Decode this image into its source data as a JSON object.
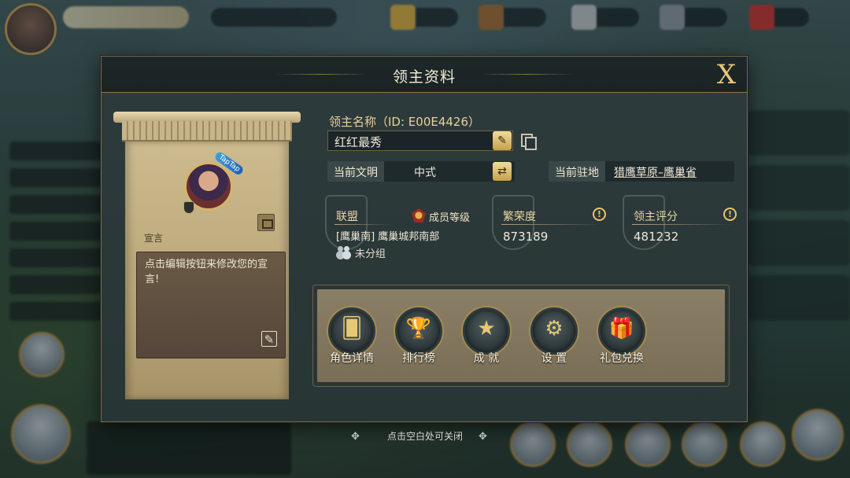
{
  "modal": {
    "title": "领主资料",
    "close_label": "X"
  },
  "profile": {
    "portrait_tag": "TapTap",
    "declaration_label": "宣言",
    "declaration_text": "点击编辑按钮来修改您的宣言!"
  },
  "lord": {
    "name_label": "领主名称（ID: E00E4426）",
    "name_value": "红红最秀",
    "civ_label": "当前文明",
    "civ_value": "中式",
    "location_label": "当前驻地",
    "location_value": "猎鹰草原–鹰巢省"
  },
  "stats": {
    "alliance_label": "联盟",
    "member_rank_label": "成员等级",
    "alliance_name": "[鹰巢南] 鹰巢城邦南部",
    "group_label": "未分组",
    "prosperity_label": "繁荣度",
    "prosperity_value": "873189",
    "score_label": "领主评分",
    "score_value": "481232",
    "info_glyph": "!"
  },
  "actions": [
    {
      "label": "角色详情",
      "icon": "cards-icon",
      "glyph": "🂠"
    },
    {
      "label": "排行榜",
      "icon": "trophy-icon",
      "glyph": "🏆"
    },
    {
      "label": "成 就",
      "icon": "star-medal-icon",
      "glyph": "★"
    },
    {
      "label": "设 置",
      "icon": "gear-icon",
      "glyph": "⚙"
    },
    {
      "label": "礼包兑换",
      "icon": "gift-icon",
      "glyph": "🎁"
    }
  ],
  "hint": "点击空白处可关闭",
  "colors": {
    "accent_gold": "#e7c77a",
    "panel_dark": "#2e3b3c",
    "parchment": "#cdbb8f"
  }
}
